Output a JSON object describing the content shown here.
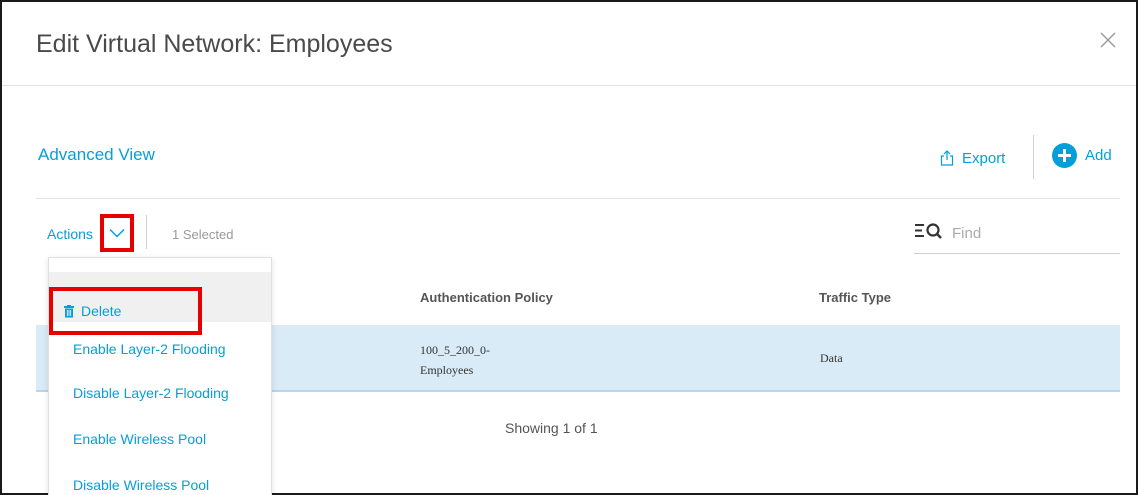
{
  "dialog": {
    "title": "Edit Virtual Network: Employees",
    "close_icon": "close-icon"
  },
  "section": {
    "title": "Advanced View"
  },
  "toolbar": {
    "export_label": "Export",
    "export_icon": "export-icon",
    "add_label": "Add",
    "add_icon": "plus-circle-icon",
    "actions_label": "Actions",
    "actions_icon": "chevron-down-icon",
    "selected_text": "1 Selected",
    "find_placeholder": "Find",
    "find_icon": "search-filter-icon"
  },
  "table": {
    "columns": [
      "Authentication Policy",
      "Traffic Type"
    ],
    "rows": [
      {
        "authentication_policy_line1": "100_5_200_0-",
        "authentication_policy_line2": "Employees",
        "traffic_type": "Data",
        "selected": true
      }
    ],
    "footer": "Showing 1 of 1"
  },
  "actions_menu": {
    "items": [
      {
        "label": "Delete",
        "icon": "trash-icon"
      },
      {
        "label": "Enable Layer-2 Flooding"
      },
      {
        "label": "Disable Layer-2 Flooding"
      },
      {
        "label": "Enable Wireless Pool"
      },
      {
        "label": "Disable Wireless Pool"
      }
    ]
  },
  "colors": {
    "accent": "#049fd9",
    "highlight": "#e60000",
    "selected_row": "#d9ebf7"
  }
}
